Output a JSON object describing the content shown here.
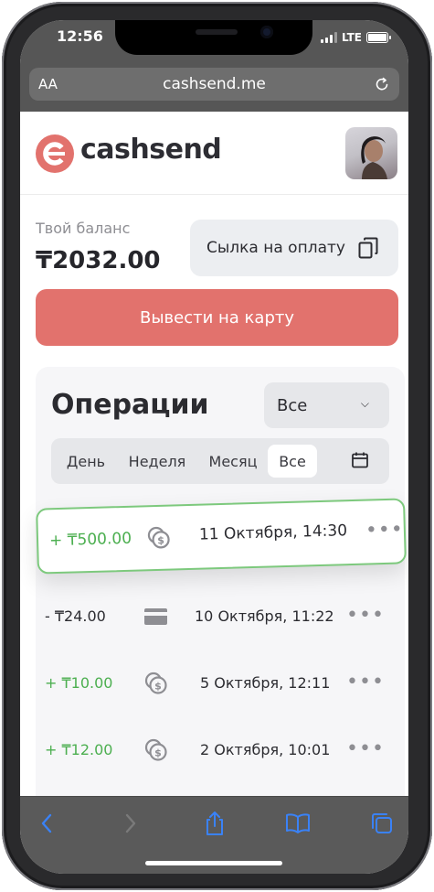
{
  "status_bar": {
    "time": "12:56",
    "network": "LTE"
  },
  "browser": {
    "text_size_label": "AA",
    "url": "cashsend.me"
  },
  "brand": {
    "name": "cashsend",
    "color": "#e2726d"
  },
  "balance": {
    "label": "Твой баланс",
    "value": "₸2032.00"
  },
  "actions": {
    "payment_link_label": "Сылка на оплату",
    "withdraw_label": "Вывести на карту"
  },
  "operations": {
    "title": "Операции",
    "filter": {
      "selected": "Все"
    },
    "periods": [
      "День",
      "Неделя",
      "Месяц",
      "Все"
    ],
    "active_period": "Все",
    "highlighted": {
      "amount": "+ ₸500.00",
      "date": "11 Октября, 14:30",
      "icon": "coins-icon",
      "type": "income"
    },
    "items": [
      {
        "amount": "- ₸24.00",
        "date": "10 Октября, 11:22",
        "icon": "card-icon",
        "type": "expense"
      },
      {
        "amount": "+ ₸10.00",
        "date": "5 Октября, 12:11",
        "icon": "coins-icon",
        "type": "income"
      },
      {
        "amount": "+ ₸12.00",
        "date": "2 Октября, 10:01",
        "icon": "coins-icon",
        "type": "income"
      }
    ]
  },
  "colors": {
    "income": "#4caf50",
    "accent": "#e2726d",
    "highlight_border": "#7dc97d",
    "ios_blue": "#3a82f7"
  }
}
